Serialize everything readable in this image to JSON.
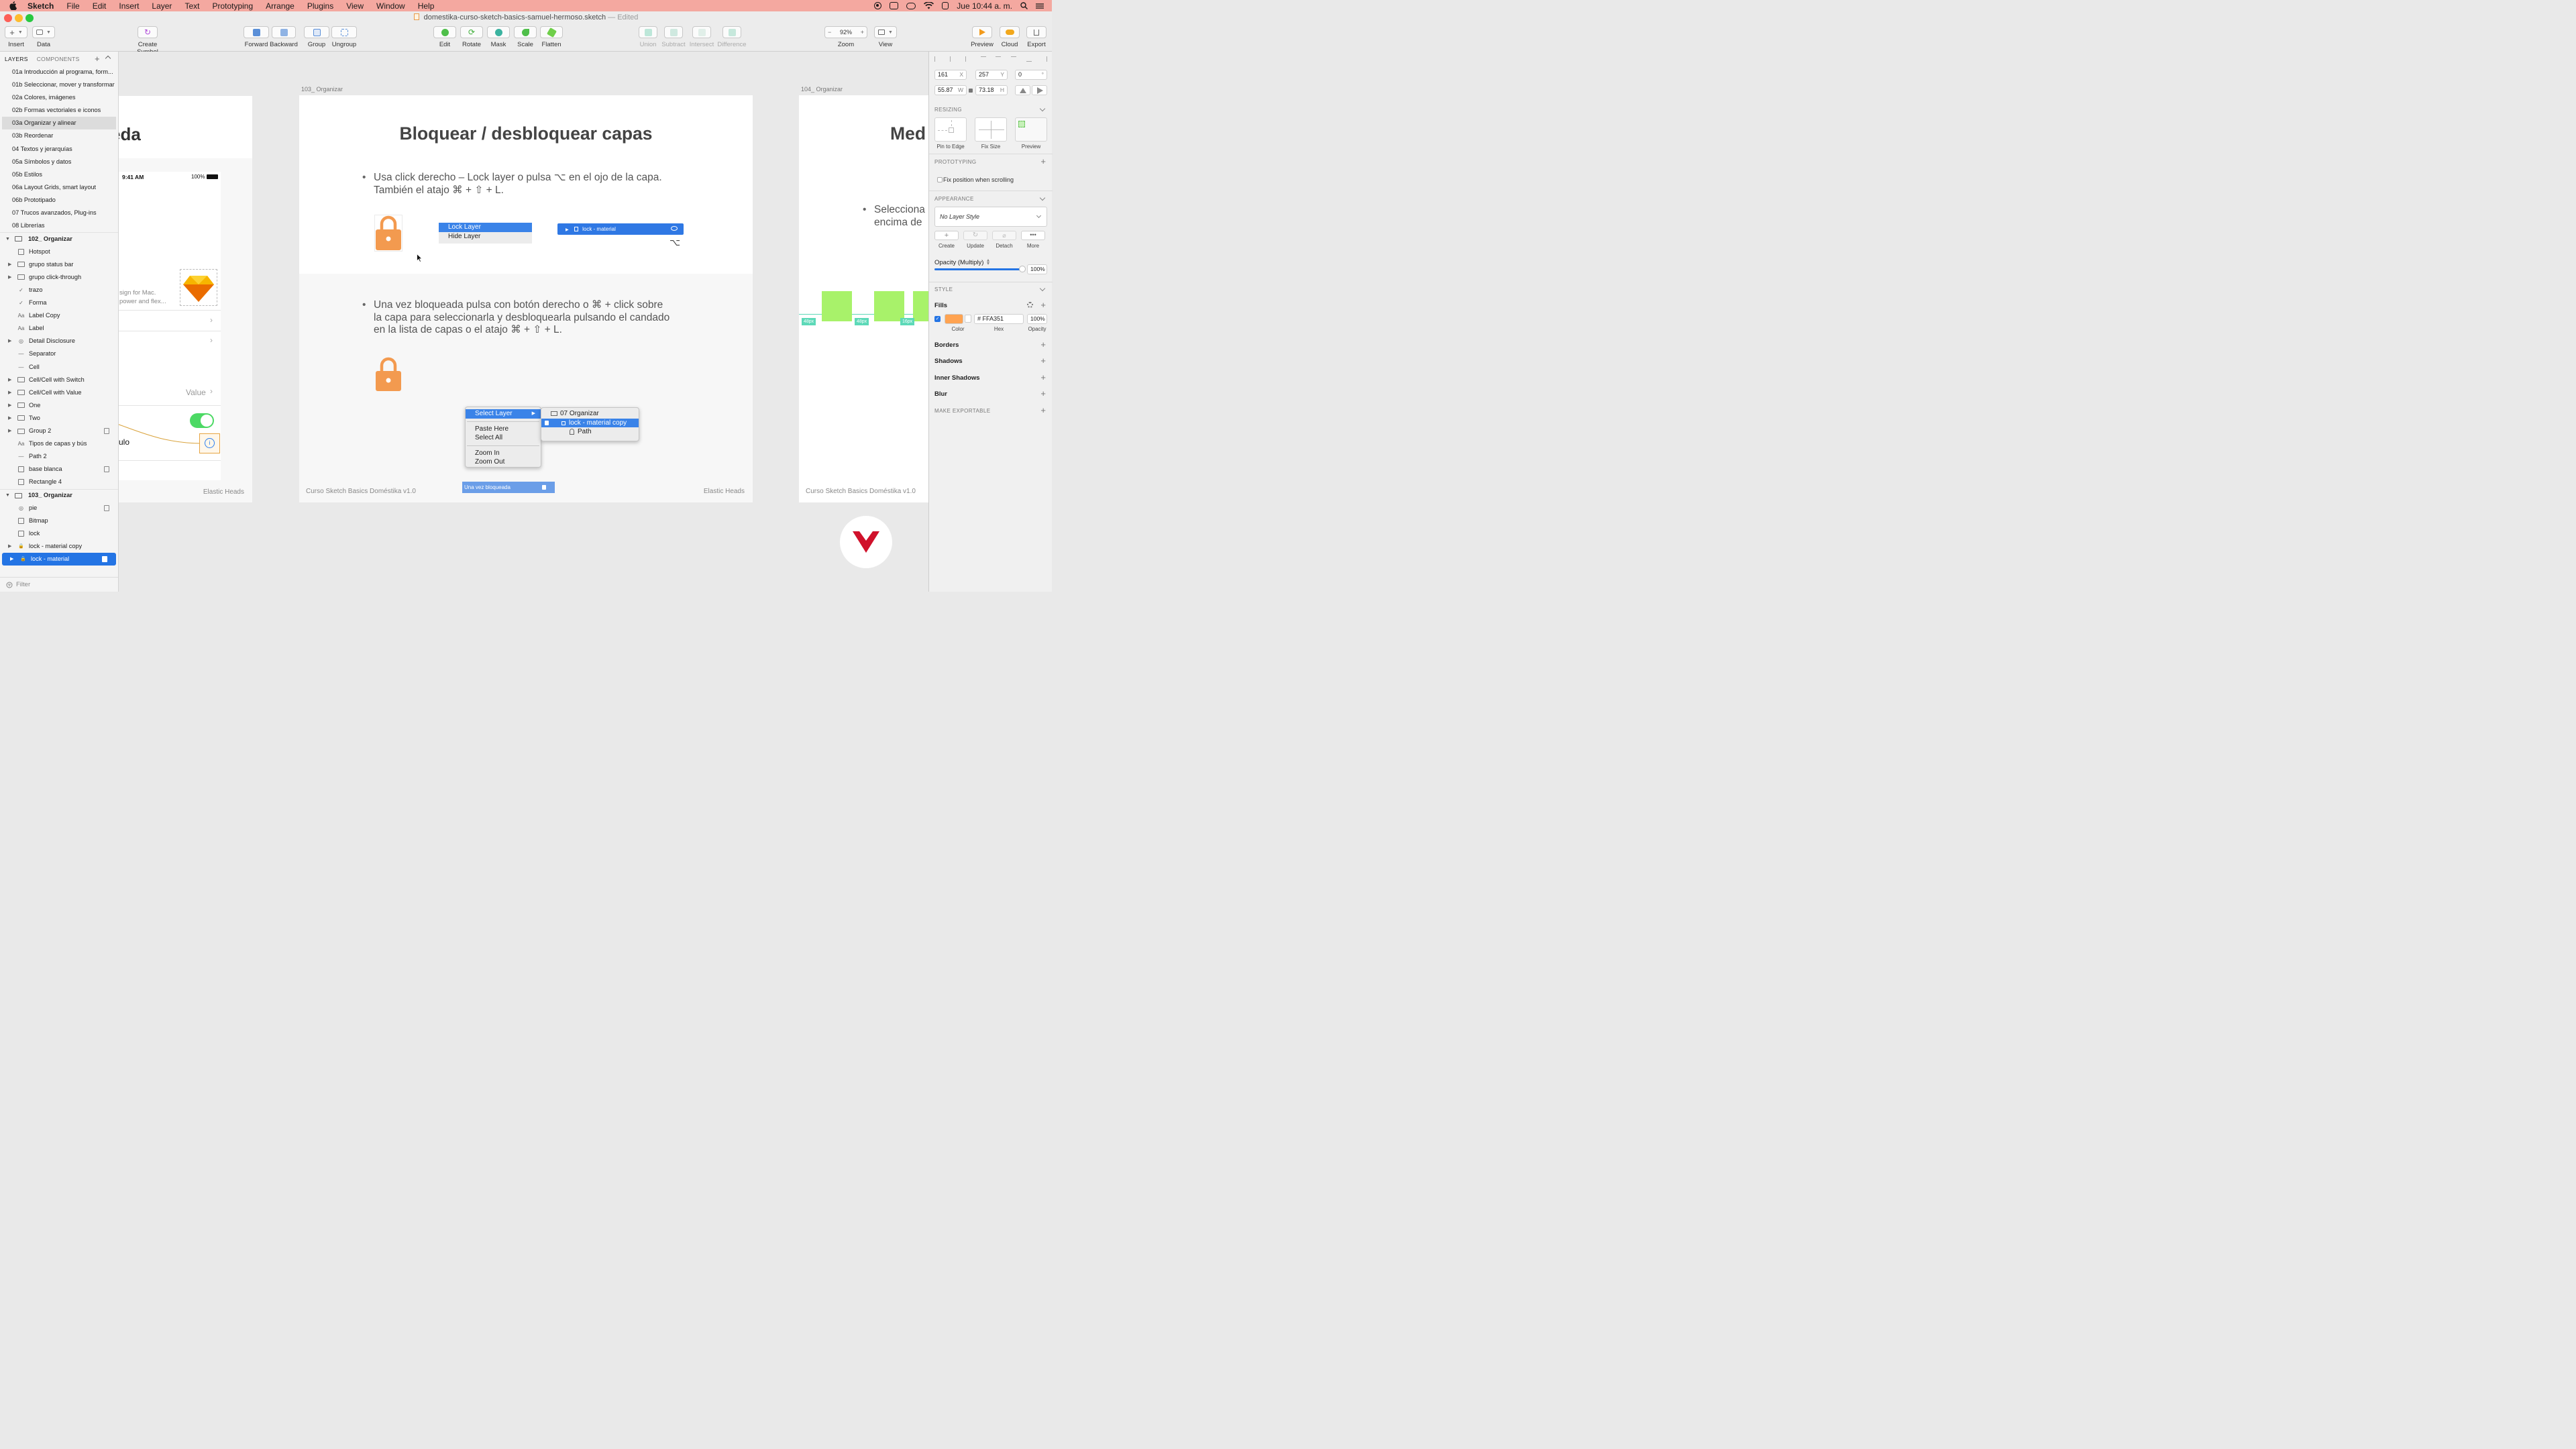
{
  "menubar": {
    "items": [
      "Sketch",
      "File",
      "Edit",
      "Insert",
      "Layer",
      "Text",
      "Prototyping",
      "Arrange",
      "Plugins",
      "View",
      "Window",
      "Help"
    ],
    "clock": "Jue 10:44 a. m."
  },
  "window": {
    "filename": "domestika-curso-sketch-basics-samuel-hermoso.sketch",
    "edited": "— Edited"
  },
  "toolbar": {
    "insert": "Insert",
    "data": "Data",
    "create_symbol": "Create Symbol",
    "forward": "Forward",
    "backward": "Backward",
    "group": "Group",
    "ungroup": "Ungroup",
    "edit": "Edit",
    "rotate": "Rotate",
    "mask": "Mask",
    "scale": "Scale",
    "flatten": "Flatten",
    "union": "Union",
    "subtract": "Subtract",
    "intersect": "Intersect",
    "difference": "Difference",
    "zoom_value": "92%",
    "zoom": "Zoom",
    "view": "View",
    "preview": "Preview",
    "cloud": "Cloud",
    "export": "Export"
  },
  "left_panel": {
    "tab_layers": "LAYERS",
    "tab_components": "COMPONENTS",
    "pages": [
      "01a Introducción al programa, form...",
      "01b Seleccionar, mover y transformar",
      "02a Colores, imágenes",
      "02b Formas vectoriales e iconos",
      "03a Organizar y alinear",
      "03b Reordenar",
      "04 Textos y jerarquías",
      "05a Símbolos y datos",
      "05b Estilos",
      "06a Layout Grids, smart layout",
      "06b Prototipado",
      "07 Trucos avanzados, Plug-ins",
      "08 Librerías"
    ],
    "artboard1": "102_ Organizar",
    "layers1": [
      {
        "name": "Hotspot",
        "icon": "hotspot-icon",
        "disc": ""
      },
      {
        "name": "grupo status bar",
        "icon": "folder-icon",
        "disc": "▶"
      },
      {
        "name": "grupo click-through",
        "icon": "folder-icon",
        "disc": "▶"
      },
      {
        "name": "trazo",
        "icon": "path-icon",
        "disc": ""
      },
      {
        "name": "Forma",
        "icon": "path-icon",
        "disc": ""
      },
      {
        "name": "Label Copy",
        "icon": "text-icon",
        "disc": ""
      },
      {
        "name": "Label",
        "icon": "text-icon",
        "disc": ""
      },
      {
        "name": "Detail Disclosure",
        "icon": "symbol-icon",
        "disc": "▶"
      },
      {
        "name": "Separator",
        "icon": "line-icon",
        "disc": ""
      },
      {
        "name": "Cell",
        "icon": "line-icon",
        "disc": ""
      },
      {
        "name": "Cell/Cell with Switch",
        "icon": "folder-icon",
        "disc": "▶"
      },
      {
        "name": "Cell/Cell with Value",
        "icon": "folder-icon",
        "disc": "▶"
      },
      {
        "name": "One",
        "icon": "folder-icon",
        "disc": "▶"
      },
      {
        "name": "Two",
        "icon": "folder-icon",
        "disc": "▶"
      },
      {
        "name": "Group 2",
        "icon": "folder-icon",
        "disc": "▶"
      },
      {
        "name": "Tipos de capas y bús",
        "icon": "text-icon",
        "disc": ""
      },
      {
        "name": "Path 2",
        "icon": "line-icon",
        "disc": ""
      },
      {
        "name": "base blanca",
        "icon": "rect-icon",
        "disc": ""
      },
      {
        "name": "Rectangle 4",
        "icon": "rect-icon",
        "disc": ""
      }
    ],
    "artboard2": "103_ Organizar",
    "layers2": [
      {
        "name": "pie",
        "icon": "symbol-icon",
        "disc": ""
      },
      {
        "name": "Bitmap",
        "icon": "bitmap-icon",
        "disc": ""
      },
      {
        "name": "lock",
        "icon": "bitmap-icon",
        "disc": ""
      },
      {
        "name": "lock - material copy",
        "icon": "lock-icon",
        "disc": "▶"
      },
      {
        "name": "lock - material",
        "icon": "lock-icon",
        "disc": "▶"
      }
    ],
    "text_glyph": "Aa",
    "filter": "Filter"
  },
  "canvas": {
    "left_artboard": {
      "title_fragment": "eda",
      "status_time": "9:41 AM",
      "battery": "100%",
      "desc_line1": "sign for Mac.",
      "desc_line2": "power and flex...",
      "value": "Value",
      "ulo": "ulo",
      "footer": "Elastic Heads"
    },
    "main_artboard": {
      "label": "103_ Organizar",
      "title": "Bloquear / desbloquear capas",
      "bullet1_line1": "Usa click derecho – Lock layer o pulsa ⌥ en el ojo de la capa.",
      "bullet1_line2": "También el atajo ⌘ + ⇧ + L.",
      "lock_layer": "Lock Layer",
      "hide_layer": "Hide Layer",
      "bar_label": "lock - material",
      "option_key": "⌥",
      "bullet2_line1": "Una vez bloqueada pulsa con botón derecho o ⌘ + click sobre",
      "bullet2_line2": "la capa para seleccionarla y desbloquearla pulsando el candado",
      "bullet2_line3": "en la lista de capas o el atajo ⌘ + ⇧ +  L.",
      "ctx_menu": [
        "Select Layer",
        "Paste Here",
        "Select All",
        "Zoom In",
        "Zoom Out"
      ],
      "submenu": [
        "07 Organizar",
        "lock - material copy",
        "Path"
      ],
      "locked_bar": "Una vez bloqueada",
      "footer_left": "Curso Sketch Basics Doméstika v1.0",
      "footer_right": "Elastic Heads"
    },
    "right_artboard": {
      "label": "104_ Organizar",
      "title_fragment": "Med",
      "bullet_line1": "Selecciona",
      "bullet_line2": "encima de",
      "px1": "48px",
      "px2": "48px",
      "px3": "16px",
      "footer": "Curso Sketch Basics Doméstika v1.0"
    }
  },
  "inspector": {
    "x": "161",
    "x_label": "X",
    "y": "257",
    "y_label": "Y",
    "rotation": "0",
    "rotation_unit": "°",
    "w": "55.87",
    "w_label": "W",
    "h": "73.18",
    "h_label": "H",
    "resizing": "RESIZING",
    "pin_to_edge": "Pin to Edge",
    "fix_size": "Fix Size",
    "preview": "Preview",
    "prototyping": "PROTOTYPING",
    "fix_position": "Fix position when scrolling",
    "appearance": "APPEARANCE",
    "layer_style": "No Layer Style",
    "create": "Create",
    "update": "Update",
    "detach": "Detach",
    "more": "More",
    "opacity_label": "Opacity (Multiply)",
    "opacity_value": "100%",
    "opacity_level": 1.0,
    "style": "STYLE",
    "fills": "Fills",
    "fill_hex": "# FFA351",
    "fill_opacity": "100%",
    "color_label": "Color",
    "hex_label": "Hex",
    "opacity_small": "Opacity",
    "borders": "Borders",
    "shadows": "Shadows",
    "inner_shadows": "Inner Shadows",
    "blur": "Blur",
    "make_exportable": "MAKE EXPORTABLE"
  },
  "colors": {
    "menubar": "#f4a8a0",
    "accent_blue": "#2474e4",
    "lock_orange": "#f39a4f",
    "fill_color": "#FFA351",
    "green_block": "#a8f26a",
    "teal_label": "#5dd9b8",
    "brand_red": "#d0112b"
  }
}
